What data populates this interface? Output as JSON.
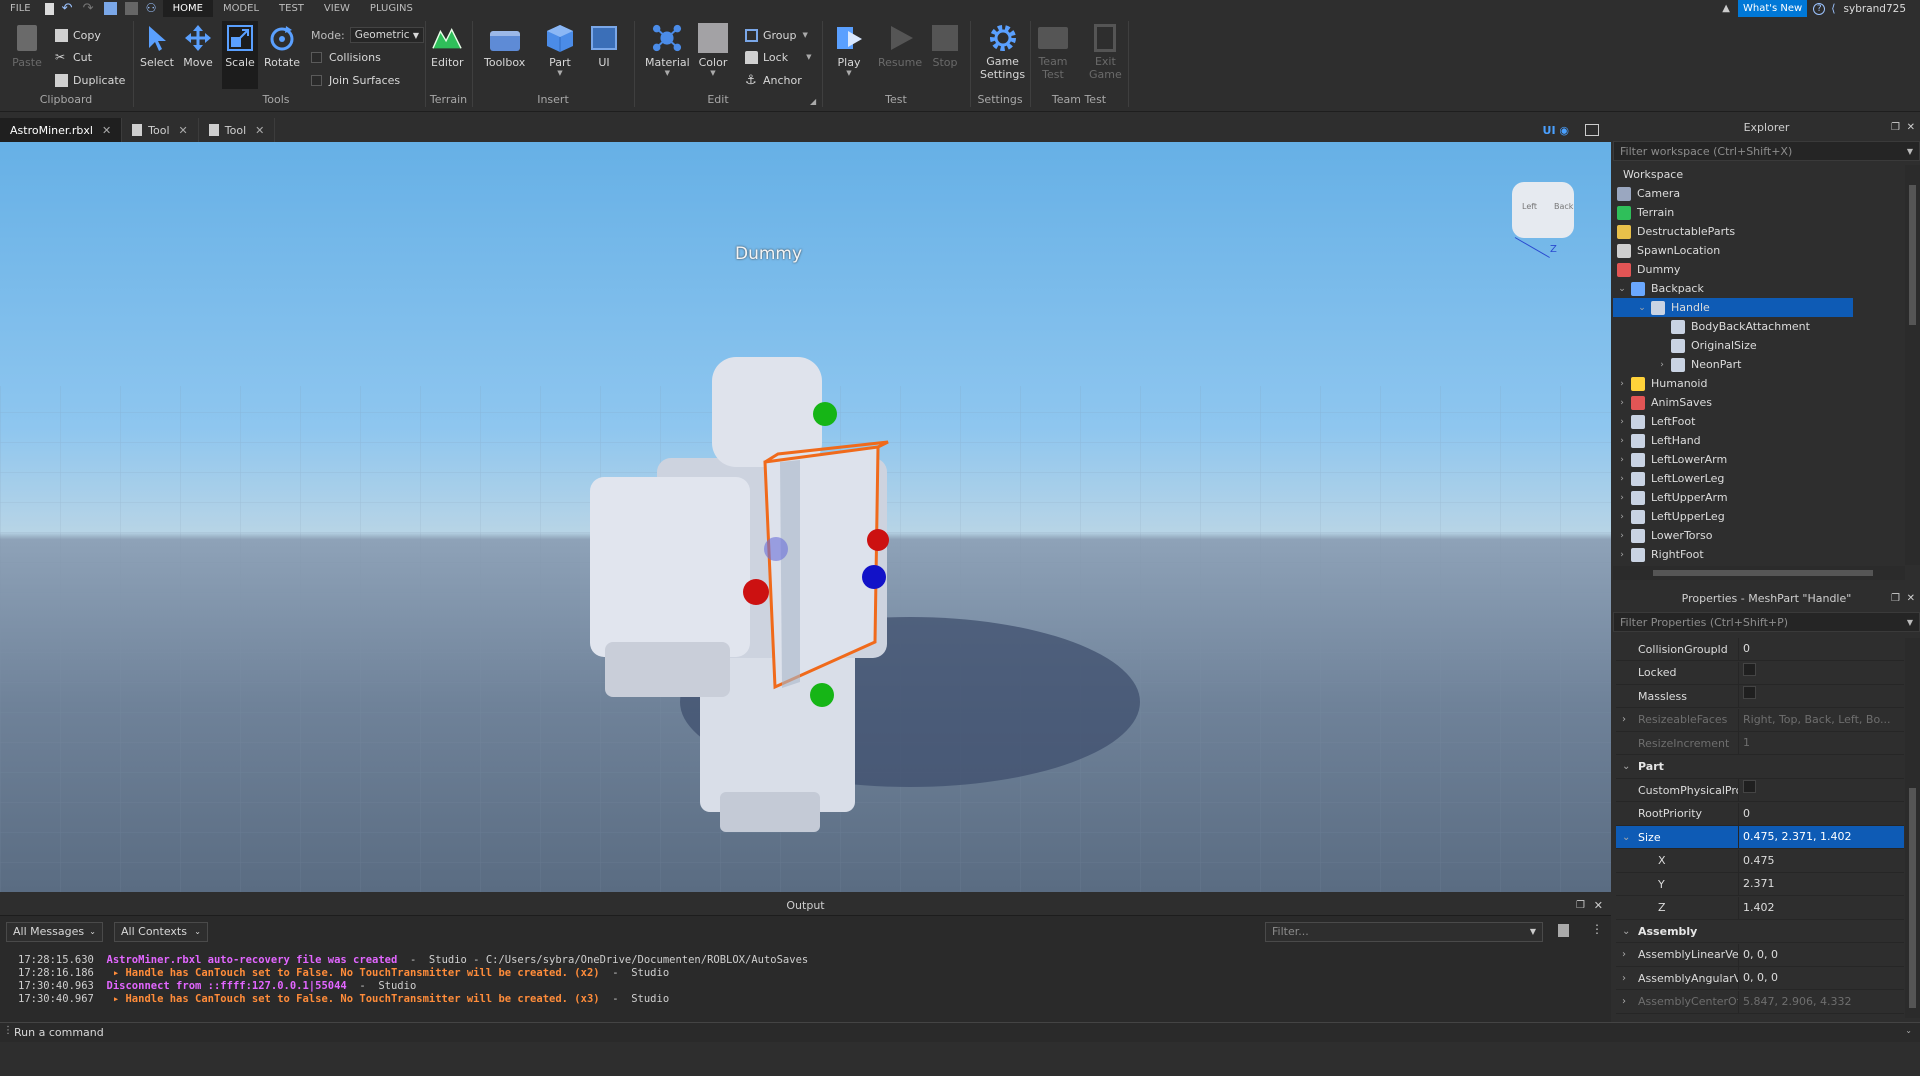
{
  "menubar": {
    "items": [
      "FILE",
      "HOME",
      "MODEL",
      "TEST",
      "VIEW",
      "PLUGINS"
    ],
    "whats_new": "What's New",
    "username": "sybrand725"
  },
  "ribbon": {
    "clipboard": {
      "paste": "Paste",
      "copy": "Copy",
      "cut": "Cut",
      "duplicate": "Duplicate",
      "label": "Clipboard"
    },
    "tools": {
      "select": "Select",
      "move": "Move",
      "scale": "Scale",
      "rotate": "Rotate",
      "mode_label": "Mode:",
      "mode_value": "Geometric",
      "collisions": "Collisions",
      "join_surfaces": "Join Surfaces",
      "label": "Tools"
    },
    "terrain": {
      "editor": "Editor",
      "label": "Terrain"
    },
    "insert": {
      "toolbox": "Toolbox",
      "part": "Part",
      "ui": "UI",
      "label": "Insert"
    },
    "edit": {
      "material": "Material",
      "color": "Color",
      "group": "Group",
      "lock": "Lock",
      "anchor": "Anchor",
      "label": "Edit"
    },
    "test": {
      "play": "Play",
      "resume": "Resume",
      "stop": "Stop",
      "label": "Test"
    },
    "settings": {
      "game_settings_1": "Game",
      "game_settings_2": "Settings",
      "label": "Settings"
    },
    "team_test": {
      "team_test_1": "Team",
      "team_test_2": "Test",
      "exit_game_1": "Exit",
      "exit_game_2": "Game",
      "label": "Team Test"
    }
  },
  "doc_tabs": [
    {
      "label": "AstroMiner.rbxl"
    },
    {
      "label": "Tool"
    },
    {
      "label": "Tool"
    }
  ],
  "viewport": {
    "ui_toggle": "UI",
    "dummy_label": "Dummy",
    "cube_left": "Left",
    "cube_back": "Back",
    "axis_z": "Z"
  },
  "output": {
    "title": "Output",
    "filter_messages": "All Messages",
    "filter_contexts": "All Contexts",
    "filter_placeholder": "Filter...",
    "lines": [
      {
        "time": "17:28:15.630",
        "msg": "AstroMiner.rbxl auto-recovery file was created",
        "suffix": "  -  Studio - C:/Users/sybra/OneDrive/Documenten/ROBLOX/AutoSaves",
        "color": "#e266ff"
      },
      {
        "time": "17:28:16.186",
        "msg": " ▸ Handle has CanTouch set to False. No TouchTransmitter will be created. (x2)",
        "suffix": "  -  Studio",
        "color": "#ff8c3a"
      },
      {
        "time": "17:30:40.963",
        "msg": "Disconnect from ::ffff:127.0.0.1|55044",
        "suffix": "  -  Studio",
        "color": "#e266ff"
      },
      {
        "time": "17:30:40.967",
        "msg": " ▸ Handle has CanTouch set to False. No TouchTransmitter will be created. (x3)",
        "suffix": "  -  Studio",
        "color": "#ff8c3a"
      }
    ]
  },
  "command_bar": {
    "placeholder": "Run a command"
  },
  "explorer": {
    "title": "Explorer",
    "filter": "Filter workspace (Ctrl+Shift+X)",
    "items": [
      {
        "label": "Workspace",
        "depth": 0,
        "icon": "workspace-icon",
        "chev": ""
      },
      {
        "label": "Camera",
        "depth": 0,
        "icon": "camera-icon",
        "chev": ""
      },
      {
        "label": "Terrain",
        "depth": 0,
        "icon": "terrain-icon",
        "chev": ""
      },
      {
        "label": "DestructableParts",
        "depth": 0,
        "icon": "folder-icon",
        "chev": ""
      },
      {
        "label": "SpawnLocation",
        "depth": 0,
        "icon": "spawn-icon",
        "chev": ""
      },
      {
        "label": "Dummy",
        "depth": 0,
        "icon": "model-icon",
        "chev": ""
      },
      {
        "label": "Backpack",
        "depth": 1,
        "icon": "tool-icon",
        "chev": "⌄"
      },
      {
        "label": "Handle",
        "depth": 2,
        "icon": "meshpart-icon",
        "chev": "⌄",
        "selected": true
      },
      {
        "label": "BodyBackAttachment",
        "depth": 3,
        "icon": "attachment-icon",
        "chev": ""
      },
      {
        "label": "OriginalSize",
        "depth": 3,
        "icon": "value-icon",
        "chev": ""
      },
      {
        "label": "NeonPart",
        "depth": 3,
        "icon": "meshpart-icon",
        "chev": "›"
      },
      {
        "label": "Humanoid",
        "depth": 1,
        "icon": "humanoid-icon",
        "chev": "›"
      },
      {
        "label": "AnimSaves",
        "depth": 1,
        "icon": "model-icon",
        "chev": "›"
      },
      {
        "label": "LeftFoot",
        "depth": 1,
        "icon": "meshpart-icon",
        "chev": "›"
      },
      {
        "label": "LeftHand",
        "depth": 1,
        "icon": "meshpart-icon",
        "chev": "›"
      },
      {
        "label": "LeftLowerArm",
        "depth": 1,
        "icon": "meshpart-icon",
        "chev": "›"
      },
      {
        "label": "LeftLowerLeg",
        "depth": 1,
        "icon": "meshpart-icon",
        "chev": "›"
      },
      {
        "label": "LeftUpperArm",
        "depth": 1,
        "icon": "meshpart-icon",
        "chev": "›"
      },
      {
        "label": "LeftUpperLeg",
        "depth": 1,
        "icon": "meshpart-icon",
        "chev": "›"
      },
      {
        "label": "LowerTorso",
        "depth": 1,
        "icon": "meshpart-icon",
        "chev": "›"
      },
      {
        "label": "RightFoot",
        "depth": 1,
        "icon": "meshpart-icon",
        "chev": "›"
      }
    ]
  },
  "properties": {
    "title": "Properties - MeshPart \"Handle\"",
    "filter": "Filter Properties (Ctrl+Shift+P)",
    "rows": [
      {
        "name": "CollisionGroupId",
        "value": "0",
        "kind": "text"
      },
      {
        "name": "Locked",
        "value": "",
        "kind": "check"
      },
      {
        "name": "Massless",
        "value": "",
        "kind": "check"
      },
      {
        "name": "ResizeableFaces",
        "value": "Right, Top, Back, Left, Bo...",
        "kind": "dim",
        "chev": "›"
      },
      {
        "name": "ResizeIncrement",
        "value": "1",
        "kind": "dim"
      },
      {
        "name": "Part",
        "value": "",
        "kind": "cat",
        "chev": "⌄"
      },
      {
        "name": "CustomPhysicalPro...",
        "value": "",
        "kind": "check"
      },
      {
        "name": "RootPriority",
        "value": "0",
        "kind": "text"
      },
      {
        "name": "Size",
        "value": "0.475, 2.371, 1.402",
        "kind": "selected",
        "chev": "⌄"
      },
      {
        "name": "X",
        "value": "0.475",
        "kind": "sub"
      },
      {
        "name": "Y",
        "value": "2.371",
        "kind": "sub"
      },
      {
        "name": "Z",
        "value": "1.402",
        "kind": "sub"
      },
      {
        "name": "Assembly",
        "value": "",
        "kind": "cat",
        "chev": "⌄"
      },
      {
        "name": "AssemblyLinearVelo...",
        "value": "0, 0, 0",
        "kind": "text",
        "chev": "›"
      },
      {
        "name": "AssemblyAngularVel...",
        "value": "0, 0, 0",
        "kind": "text",
        "chev": "›"
      },
      {
        "name": "AssemblyCenterOfM...",
        "value": "5.847, 2.906, 4.332",
        "kind": "dim",
        "chev": "›"
      }
    ]
  },
  "colors": {
    "accent": "#0078d7",
    "selection": "#0e5bb5",
    "brand_orange": "#f06a1b"
  }
}
